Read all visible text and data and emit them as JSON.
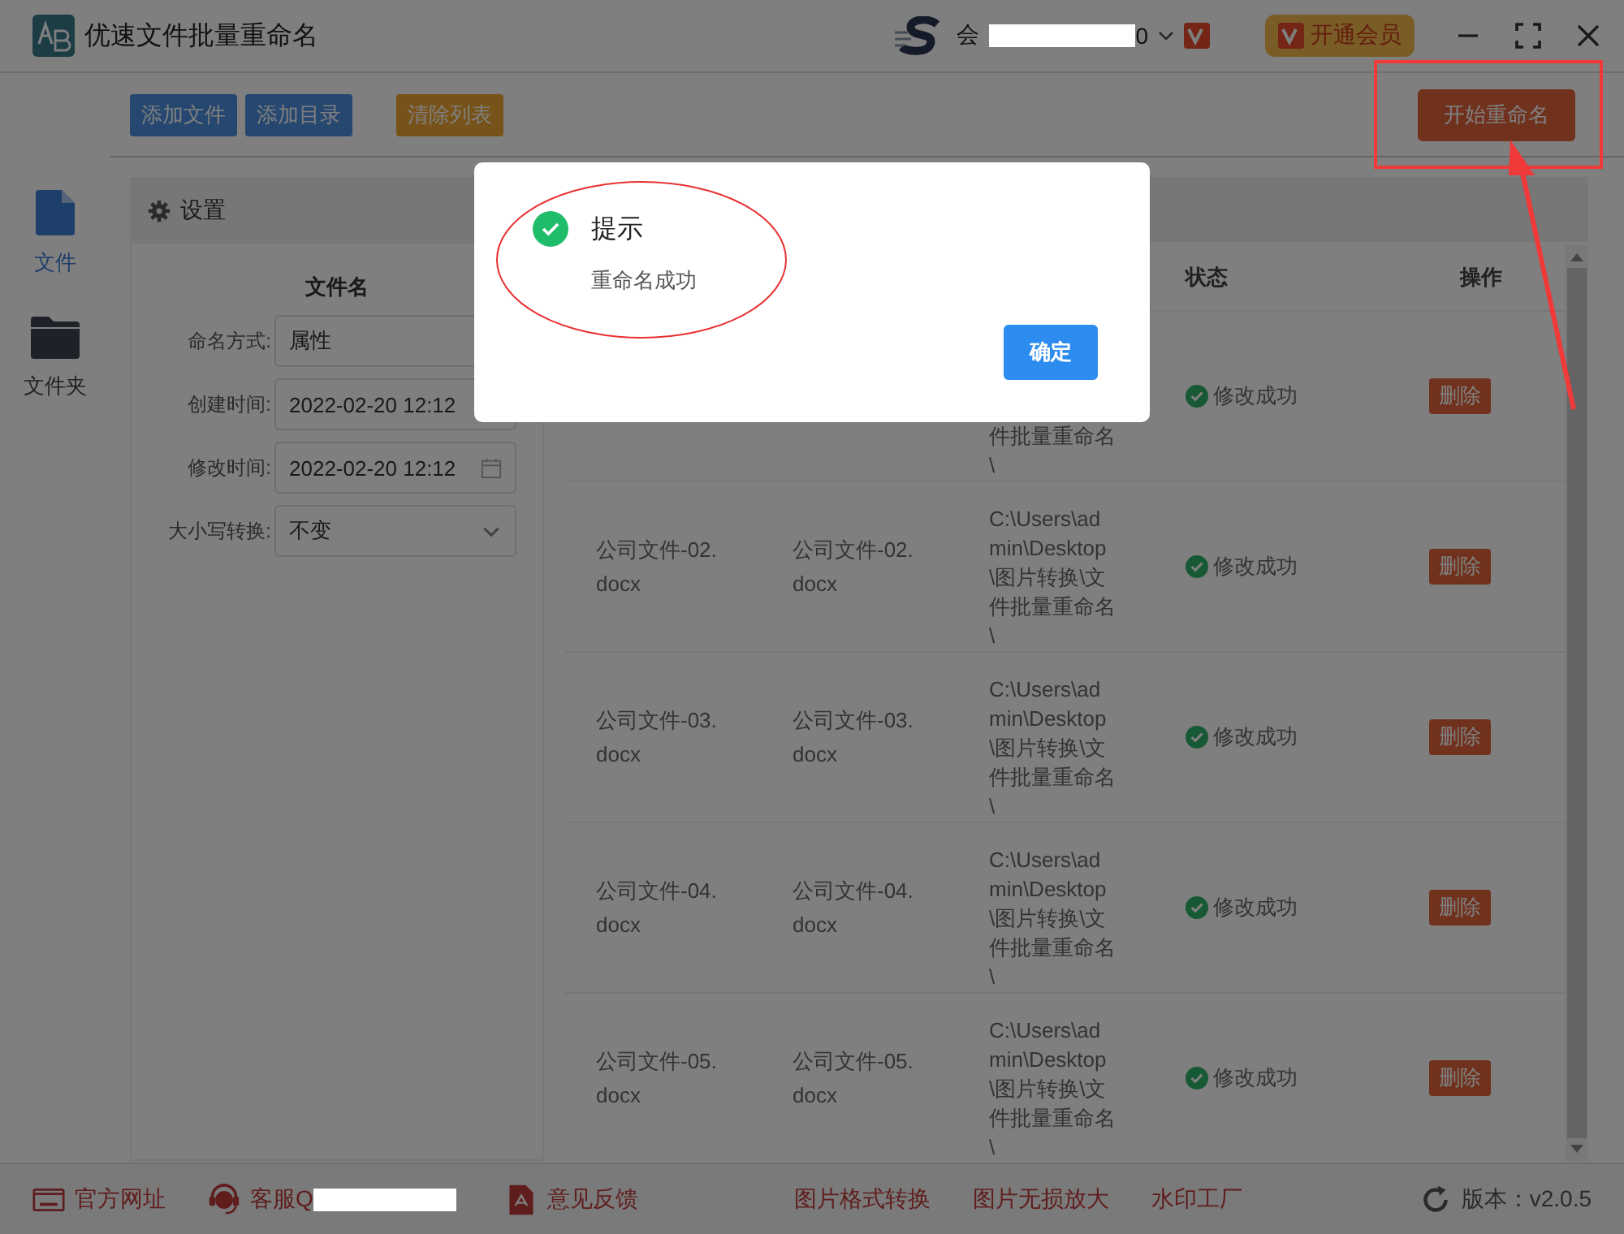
{
  "window": {
    "title": "优速文件批量重命名",
    "account_prefix": "会",
    "account_suffix": "0",
    "vip_button": "开通会员"
  },
  "toolbar": {
    "buttons": [
      {
        "label": "添加文件",
        "kind": "blue"
      },
      {
        "label": "添加目录",
        "kind": "blue"
      },
      {
        "label": "清除列表",
        "kind": "orange"
      }
    ],
    "start_button": "开始重命名"
  },
  "sidebar": {
    "items": [
      {
        "label": "文件",
        "kind": "file",
        "selected": true
      },
      {
        "label": "文件夹",
        "kind": "folder",
        "selected": false
      }
    ]
  },
  "settings": {
    "title": "设置",
    "section": "文件名",
    "fields": [
      {
        "label": "命名方式:",
        "value": "属性",
        "kind": "plain"
      },
      {
        "label": "创建时间:",
        "value": "2022-02-20 12:12",
        "kind": "plain"
      },
      {
        "label": "修改时间:",
        "value": "2022-02-20 12:12",
        "kind": "date"
      },
      {
        "label": "大小写转换:",
        "value": "不变",
        "kind": "select"
      }
    ]
  },
  "table": {
    "columns": [
      "状态",
      "操作"
    ],
    "rows": [
      {
        "path_lines": [
          "件批量重命名",
          "\\"
        ],
        "status": "修改成功",
        "action": "删除"
      },
      {
        "original": "公司文件-02.docx",
        "new_name": "公司文件-02.docx",
        "path_lines": [
          "C:\\Users\\ad",
          "min\\Desktop",
          "\\图片转换\\文",
          "件批量重命名",
          "\\"
        ],
        "status": "修改成功",
        "action": "删除"
      },
      {
        "original": "公司文件-03.docx",
        "new_name": "公司文件-03.docx",
        "path_lines": [
          "C:\\Users\\ad",
          "min\\Desktop",
          "\\图片转换\\文",
          "件批量重命名",
          "\\"
        ],
        "status": "修改成功",
        "action": "删除"
      },
      {
        "original": "公司文件-04.docx",
        "new_name": "公司文件-04.docx",
        "path_lines": [
          "C:\\Users\\ad",
          "min\\Desktop",
          "\\图片转换\\文",
          "件批量重命名",
          "\\"
        ],
        "status": "修改成功",
        "action": "删除"
      },
      {
        "original": "公司文件-05.docx",
        "new_name": "公司文件-05.docx",
        "path_lines": [
          "C:\\Users\\ad",
          "min\\Desktop",
          "\\图片转换\\文",
          "件批量重命名",
          "\\"
        ],
        "status": "修改成功",
        "action": "删除"
      }
    ]
  },
  "footer": {
    "links": [
      {
        "label": "官方网址",
        "kind": "web"
      },
      {
        "label": "客服Q",
        "kind": "support"
      },
      {
        "label": "意见反馈",
        "kind": "feedback"
      },
      {
        "label": "图片格式转换",
        "kind": "plain"
      },
      {
        "label": "图片无损放大",
        "kind": "plain"
      },
      {
        "label": "水印工厂",
        "kind": "plain"
      }
    ],
    "version": "版本：v2.0.5"
  },
  "dialog": {
    "title": "提示",
    "message": "重命名成功",
    "ok_button": "确定"
  }
}
